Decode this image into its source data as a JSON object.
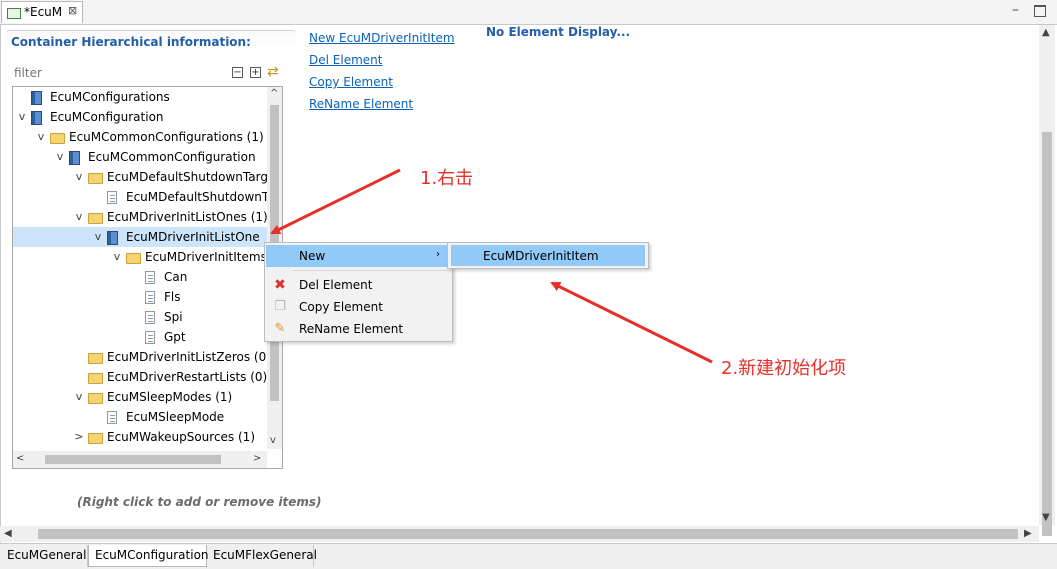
{
  "editor": {
    "tab_title": "*EcuM",
    "close_glyph": "⊠",
    "minimize_glyph": "–"
  },
  "tree_panel": {
    "header": "Container Hierarchical information:",
    "filter_placeholder": "filter",
    "tool_icons": [
      "collapse-all-icon",
      "expand-all-icon",
      "sync-icon"
    ],
    "rows": [
      {
        "label": "EcuMConfigurations",
        "icon": "module-icon",
        "twisty": ""
      },
      {
        "label": "EcuMConfiguration",
        "icon": "module-icon",
        "twisty": "v"
      },
      {
        "label": "EcuMCommonConfigurations (1)",
        "icon": "folder-icon",
        "twisty": "v"
      },
      {
        "label": "EcuMCommonConfiguration",
        "icon": "module-icon",
        "twisty": "v"
      },
      {
        "label": "EcuMDefaultShutdownTarg",
        "icon": "folder-icon",
        "twisty": "v"
      },
      {
        "label": "EcuMDefaultShutdownT",
        "icon": "document-icon",
        "twisty": ""
      },
      {
        "label": "EcuMDriverInitListOnes (1)",
        "icon": "folder-icon",
        "twisty": "v"
      },
      {
        "label": "EcuMDriverInitListOne",
        "icon": "module-icon",
        "twisty": "v"
      },
      {
        "label": "EcuMDriverInitItems",
        "icon": "folder-icon",
        "twisty": "v"
      },
      {
        "label": "Can",
        "icon": "document-icon",
        "twisty": ""
      },
      {
        "label": "Fls",
        "icon": "document-icon",
        "twisty": ""
      },
      {
        "label": "Spi",
        "icon": "document-icon",
        "twisty": ""
      },
      {
        "label": "Gpt",
        "icon": "document-icon",
        "twisty": ""
      },
      {
        "label": "EcuMDriverInitListZeros (0)",
        "icon": "folder-icon",
        "twisty": ""
      },
      {
        "label": "EcuMDriverRestartLists (0)",
        "icon": "folder-icon",
        "twisty": ""
      },
      {
        "label": "EcuMSleepModes (1)",
        "icon": "folder-icon",
        "twisty": "v"
      },
      {
        "label": "EcuMSleepMode",
        "icon": "document-icon",
        "twisty": ""
      },
      {
        "label": "EcuMWakeupSources (1)",
        "icon": "folder-icon",
        "twisty": ">"
      }
    ],
    "selected_row": "EcuMDriverInitListOne"
  },
  "actions": {
    "new_item": "New EcuMDriverInitItem",
    "del": "Del Element",
    "copy": "Copy Element",
    "rename": "ReName Element"
  },
  "details": {
    "no_element": "No Element Display..."
  },
  "context_menu": {
    "new": "New",
    "new_arrow": "›",
    "del": "Del Element",
    "copy": "Copy Element",
    "rename": "ReName Element",
    "submenu_item": "EcuMDriverInitItem"
  },
  "annotations": {
    "step1": "1.右击",
    "step2": "2.新建初始化项",
    "color": "#e8302a"
  },
  "hint": "(Right click to add or remove items)",
  "bottom_tabs": [
    {
      "label": "EcuMGeneral",
      "active": false
    },
    {
      "label": "EcuMConfiguration",
      "active": true
    },
    {
      "label": "EcuMFlexGeneral",
      "active": false
    }
  ],
  "scroll_glyphs": {
    "up": "▲",
    "down": "▼",
    "left": "◀",
    "right": "▶",
    "tree_up": "^",
    "tree_down": "v",
    "tree_left": "<",
    "tree_right": ">"
  }
}
